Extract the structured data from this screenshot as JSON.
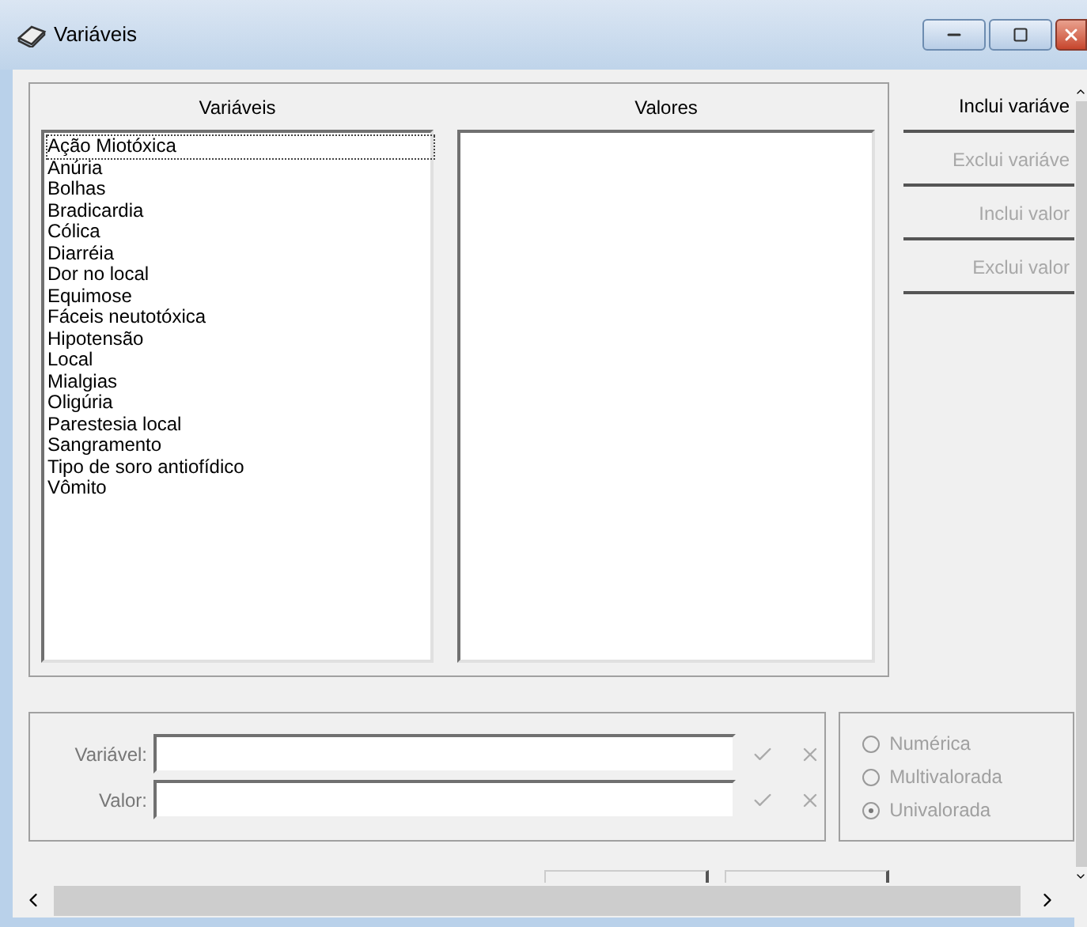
{
  "window": {
    "title": "Variáveis"
  },
  "variables_list": {
    "heading": "Variáveis",
    "items": [
      {
        "label": "Ação Miotóxica",
        "selected": true
      },
      {
        "label": "Anúria",
        "selected": false
      },
      {
        "label": "Bolhas",
        "selected": false
      },
      {
        "label": "Bradicardia",
        "selected": false
      },
      {
        "label": "Cólica",
        "selected": false
      },
      {
        "label": "Diarréia",
        "selected": false
      },
      {
        "label": "Dor no local",
        "selected": false
      },
      {
        "label": "Equimose",
        "selected": false
      },
      {
        "label": "Fáceis neutotóxica",
        "selected": false
      },
      {
        "label": "Hipotensão",
        "selected": false
      },
      {
        "label": "Local",
        "selected": false
      },
      {
        "label": "Mialgias",
        "selected": false
      },
      {
        "label": "Oligúria",
        "selected": false
      },
      {
        "label": "Parestesia local",
        "selected": false
      },
      {
        "label": "Sangramento",
        "selected": false
      },
      {
        "label": "Tipo de soro antiofídico",
        "selected": false
      },
      {
        "label": "Vômito",
        "selected": false
      }
    ]
  },
  "values_list": {
    "heading": "Valores"
  },
  "action_buttons": [
    {
      "label": "Inclui variáve",
      "disabled": false
    },
    {
      "label": "Exclui variáve",
      "disabled": true
    },
    {
      "label": "Inclui valor",
      "disabled": true
    },
    {
      "label": "Exclui valor",
      "disabled": true
    }
  ],
  "fields": [
    {
      "label": "Variável:"
    },
    {
      "label": "Valor:"
    }
  ],
  "type_options": [
    {
      "label": "Numérica",
      "selected": false,
      "disabled": true
    },
    {
      "label": "Multivalorada",
      "selected": false,
      "disabled": true
    },
    {
      "label": "Univalorada",
      "selected": true,
      "disabled": true
    }
  ]
}
